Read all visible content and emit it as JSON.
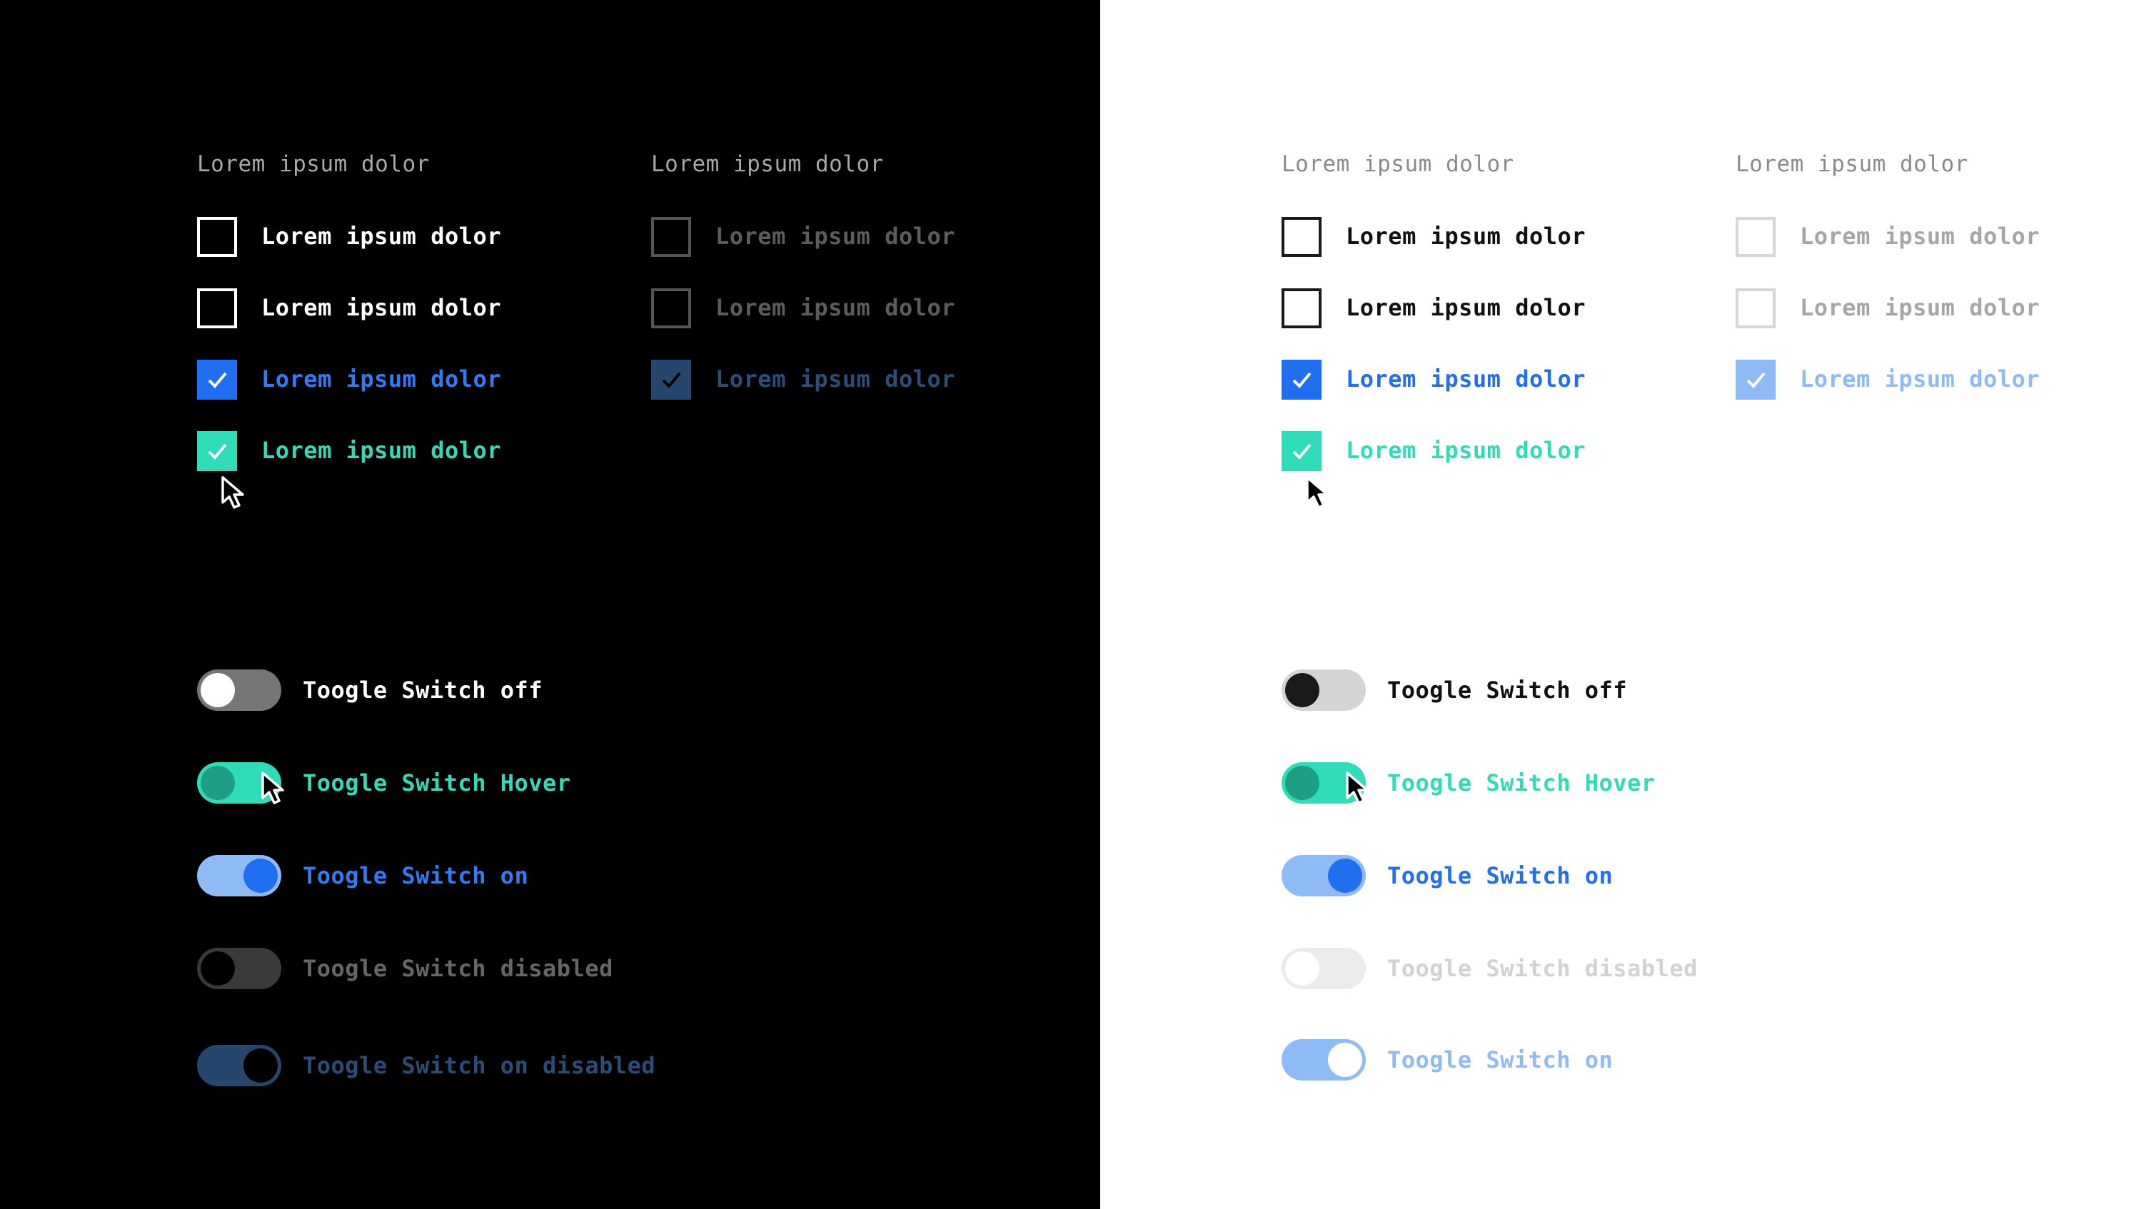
{
  "colors": {
    "dark_bg": "#000000",
    "light_bg": "#ffffff",
    "blue": "#1f6ff0",
    "teal": "#2edcb8",
    "disabled_blue_dark": "#27466e",
    "disabled_blue_light": "#8ebaf5"
  },
  "dark": {
    "enabled": {
      "header": "Lorem ipsum dolor",
      "items": [
        {
          "label": "Lorem ipsum dolor",
          "state": "unchecked"
        },
        {
          "label": "Lorem ipsum dolor",
          "state": "unchecked"
        },
        {
          "label": "Lorem ipsum dolor",
          "state": "checked"
        },
        {
          "label": "Lorem ipsum dolor",
          "state": "checked-hover"
        }
      ]
    },
    "disabled": {
      "header": "Lorem ipsum dolor",
      "items": [
        {
          "label": "Lorem ipsum dolor",
          "state": "unchecked-disabled"
        },
        {
          "label": "Lorem ipsum dolor",
          "state": "unchecked-disabled"
        },
        {
          "label": "Lorem ipsum dolor",
          "state": "checked-disabled"
        }
      ]
    },
    "toggles": [
      {
        "label": "Toogle Switch off",
        "state": "off",
        "on": false
      },
      {
        "label": "Toogle Switch Hover",
        "state": "hover",
        "on": false
      },
      {
        "label": "Toogle Switch on",
        "state": "on",
        "on": true
      },
      {
        "label": "Toogle Switch disabled",
        "state": "disabled",
        "on": false
      },
      {
        "label": "Toogle Switch on disabled",
        "state": "on-disabled",
        "on": true
      }
    ]
  },
  "light": {
    "enabled": {
      "header": "Lorem ipsum dolor",
      "items": [
        {
          "label": "Lorem ipsum dolor",
          "state": "unchecked"
        },
        {
          "label": "Lorem ipsum dolor",
          "state": "unchecked"
        },
        {
          "label": "Lorem ipsum dolor",
          "state": "checked"
        },
        {
          "label": "Lorem ipsum dolor",
          "state": "checked-hover"
        }
      ]
    },
    "disabled": {
      "header": "Lorem ipsum dolor",
      "items": [
        {
          "label": "Lorem ipsum dolor",
          "state": "unchecked-disabled"
        },
        {
          "label": "Lorem ipsum dolor",
          "state": "unchecked-disabled"
        },
        {
          "label": "Lorem ipsum dolor",
          "state": "checked-disabled"
        }
      ]
    },
    "toggles": [
      {
        "label": "Toogle Switch off",
        "state": "off",
        "on": false
      },
      {
        "label": "Toogle Switch Hover",
        "state": "hover",
        "on": false
      },
      {
        "label": "Toogle Switch on",
        "state": "on",
        "on": true
      },
      {
        "label": "Toogle Switch disabled",
        "state": "disabled",
        "on": false
      },
      {
        "label": "Toogle Switch on",
        "state": "on-disabled",
        "on": true
      }
    ]
  },
  "icons": {
    "check": "check-icon",
    "cursor": "cursor-arrow-icon"
  }
}
